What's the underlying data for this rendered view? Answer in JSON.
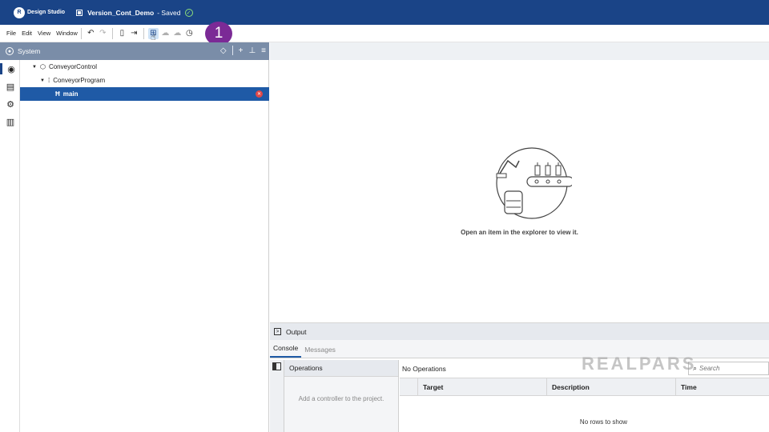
{
  "titlebar": {
    "logo_mark": "R",
    "app_name": "Design Studio",
    "doc_title": "Version_Cont_Demo",
    "status": "- Saved"
  },
  "menu": {
    "items": [
      "File",
      "Edit",
      "View",
      "Window"
    ]
  },
  "toolbar": {
    "buttons": [
      "undo-icon",
      "redo-icon",
      "doc-icon",
      "export-icon",
      "commit-icon",
      "upload-icon",
      "download-icon",
      "history-icon"
    ]
  },
  "step_badge": "1",
  "explorer": {
    "title": "System",
    "tree": [
      {
        "label": "ConveyorControl",
        "level": 1,
        "expanded": true
      },
      {
        "label": "ConveyorProgram",
        "level": 2,
        "expanded": true
      },
      {
        "label": "main",
        "level": 3,
        "selected": true,
        "status": "error"
      }
    ]
  },
  "workspace": {
    "empty_message": "Open an item in the explorer to view it."
  },
  "output": {
    "title": "Output",
    "tabs": [
      "Console",
      "Messages"
    ],
    "active_tab": "Console",
    "operations_title": "Operations",
    "operations_hint": "Add a controller to the project.",
    "detail_title": "No Operations",
    "search_placeholder": "Search",
    "columns": [
      "Target",
      "Description",
      "Time"
    ],
    "empty_rows": "No rows to show"
  },
  "watermark": "REALPARS",
  "colors": {
    "titlebar": "#1a4487",
    "explorer_header": "#7a8da8",
    "selection": "#1f5aa6",
    "badge": "#7b2a96",
    "error": "#e04848"
  }
}
